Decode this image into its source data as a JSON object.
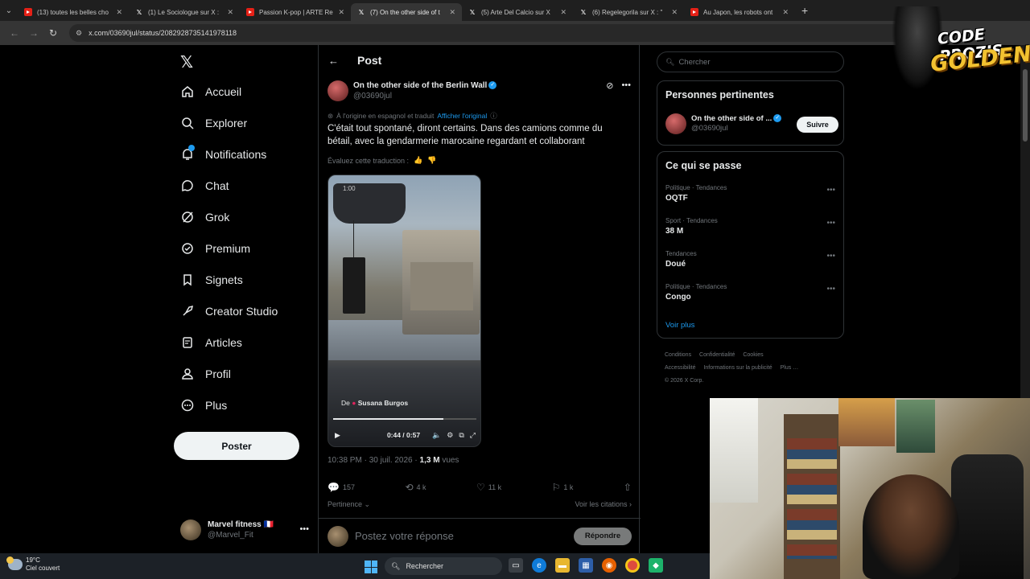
{
  "browser": {
    "tabs": [
      {
        "title": "(13) toutes les belles cho",
        "icon": "youtube-icon",
        "active": false
      },
      {
        "title": "(1) Le Sociologue sur X :",
        "icon": "x-icon",
        "active": false
      },
      {
        "title": "Passion K-pop | ARTE Re",
        "icon": "youtube-icon",
        "active": false
      },
      {
        "title": "(7) On the other side of t",
        "icon": "x-icon",
        "active": true
      },
      {
        "title": "(5) Arte Del Calcio sur X",
        "icon": "x-icon",
        "active": false
      },
      {
        "title": "(6) Regelegorila sur X : \"",
        "icon": "x-icon",
        "active": false
      },
      {
        "title": "Au Japon, les robots ont",
        "icon": "youtube-icon",
        "active": false
      }
    ],
    "url": "x.com/03690jul/status/2082928735141978118"
  },
  "nav": {
    "items": [
      {
        "label": "Accueil",
        "icon": "home-icon"
      },
      {
        "label": "Explorer",
        "icon": "search-icon"
      },
      {
        "label": "Notifications",
        "icon": "bell-icon"
      },
      {
        "label": "Chat",
        "icon": "chat-icon"
      },
      {
        "label": "Grok",
        "icon": "grok-icon"
      },
      {
        "label": "Premium",
        "icon": "premium-icon"
      },
      {
        "label": "Signets",
        "icon": "bookmark-icon"
      },
      {
        "label": "Creator Studio",
        "icon": "rocket-icon"
      },
      {
        "label": "Articles",
        "icon": "article-icon"
      },
      {
        "label": "Profil",
        "icon": "profile-icon"
      },
      {
        "label": "Plus",
        "icon": "more-circle-icon"
      }
    ],
    "post_button": "Poster",
    "account": {
      "name": "Marvel fitness 🇫🇷",
      "handle": "@Marvel_Fit"
    }
  },
  "post": {
    "header_title": "Post",
    "author_name": "On the other side of the Berlin Wall",
    "author_handle": "@03690jul",
    "translated_note": "À l'origine en espagnol et traduit",
    "show_original": "Afficher l'original",
    "text": "C'était tout spontané, diront certains. Dans des camions comme du bétail, avec la gendarmerie marocaine regardant et collaborant",
    "rate_translation": "Évaluez cette traduction :",
    "video": {
      "overlay_time": "1:00",
      "credit_prefix": "De",
      "credit_name": "Susana Burgos",
      "time": "0:44 / 0:57",
      "progress": 0.77
    },
    "timestamp": "10:38 PM · 30 juil. 2026 ·",
    "views_count": "1,3 M",
    "views_label": "vues",
    "replies": "157",
    "reposts": "4 k",
    "likes": "11 k",
    "bookmarks": "1 k",
    "relevance": "Pertinence",
    "quotes": "Voir les citations",
    "reply_placeholder": "Postez votre réponse",
    "reply_button": "Répondre"
  },
  "right": {
    "search_placeholder": "Chercher",
    "relevant_title": "Personnes pertinentes",
    "relevant_person": {
      "name": "On the other side of ...",
      "handle": "@03690jul",
      "follow": "Suivre"
    },
    "trends_title": "Ce qui se passe",
    "trends": [
      {
        "category": "Politique · Tendances",
        "name": "OQTF"
      },
      {
        "category": "Sport · Tendances",
        "name": "38 M"
      },
      {
        "category": "Tendances",
        "name": "Doué"
      },
      {
        "category": "Politique · Tendances",
        "name": "Congo"
      }
    ],
    "see_more": "Voir plus",
    "footer": [
      "Conditions",
      "Confidentialité",
      "Cookies",
      "Accessibilité",
      "Informations sur la publicité",
      "Plus …",
      "© 2026 X Corp."
    ]
  },
  "overlay": {
    "logo_line1": "CODE PROZIS",
    "logo_line2": "GOLDENG"
  },
  "taskbar": {
    "temperature": "19°C",
    "weather": "Ciel couvert",
    "search": "Rechercher"
  },
  "colors": {
    "accent": "#1d9bf0",
    "background": "#000000",
    "border": "#2f3336",
    "muted_text": "#71767b"
  }
}
